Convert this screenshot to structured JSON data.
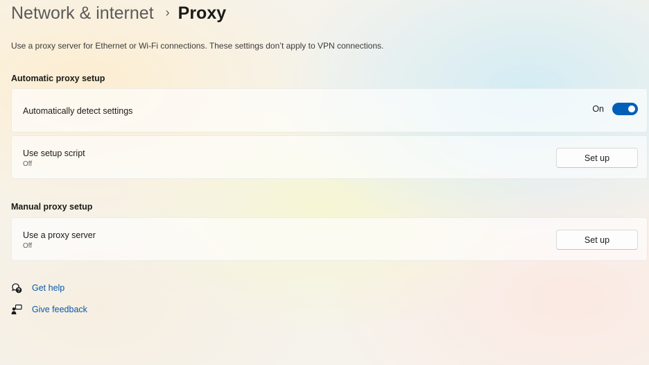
{
  "breadcrumb": {
    "parent": "Network & internet",
    "separator": "›",
    "current": "Proxy"
  },
  "description": "Use a proxy server for Ethernet or Wi-Fi connections. These settings don’t apply to VPN connections.",
  "automatic": {
    "title": "Automatic proxy setup",
    "detect": {
      "label": "Automatically detect settings",
      "state_label": "On",
      "enabled": true
    },
    "script": {
      "label": "Use setup script",
      "status": "Off",
      "button": "Set up"
    }
  },
  "manual": {
    "title": "Manual proxy setup",
    "proxy": {
      "label": "Use a proxy server",
      "status": "Off",
      "button": "Set up"
    }
  },
  "links": [
    {
      "label": "Get help",
      "icon": "help-icon"
    },
    {
      "label": "Give feedback",
      "icon": "feedback-icon"
    }
  ],
  "colors": {
    "accent": "#005fb8",
    "link": "#0a58ad"
  }
}
